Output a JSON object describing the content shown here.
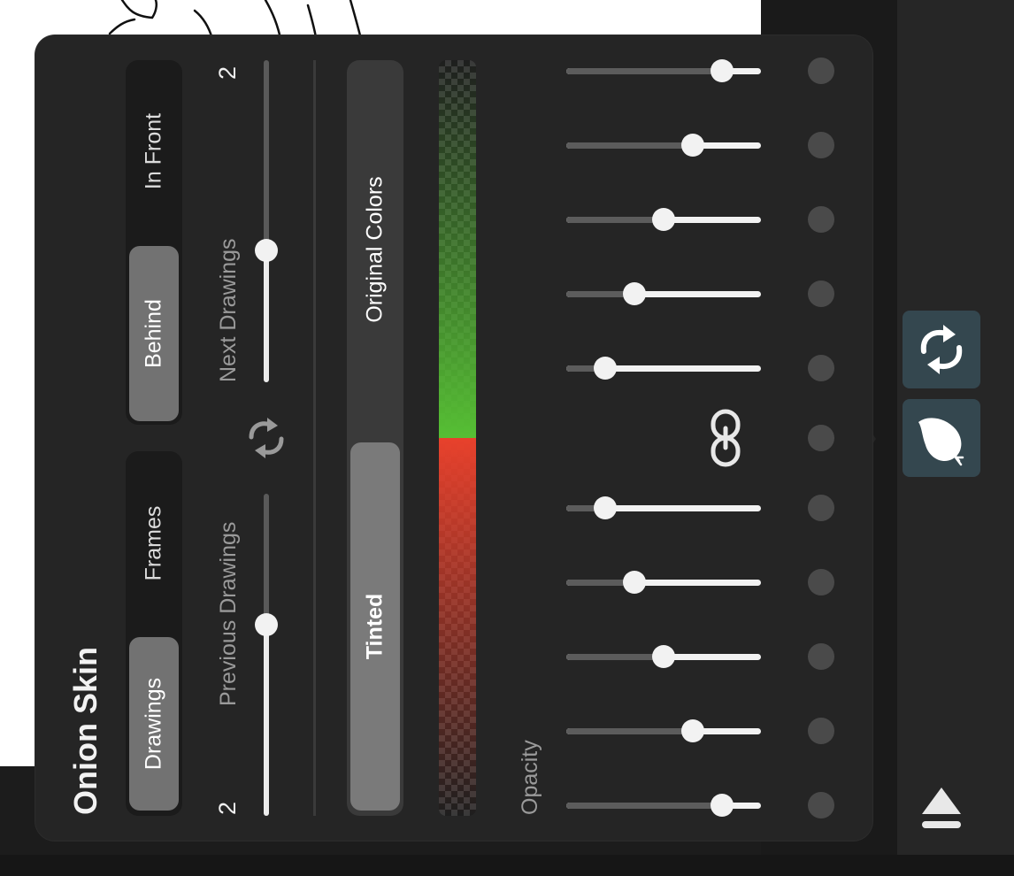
{
  "panel": {
    "title": "Onion Skin",
    "mode_segment": {
      "options": [
        "Drawings",
        "Frames"
      ],
      "selected": "Drawings"
    },
    "position_segment": {
      "options": [
        "Behind",
        "In Front"
      ],
      "selected": "Behind"
    },
    "previous": {
      "label": "Previous Drawings",
      "count": "2",
      "value": 2
    },
    "next": {
      "label": "Next Drawings",
      "count": "2",
      "value": 2
    },
    "color_segment": {
      "options": [
        "Tinted",
        "Original Colors"
      ],
      "selected": "Tinted"
    },
    "tint_colors": {
      "previous": "#e8412c",
      "next": "#56bf34"
    },
    "opacity": {
      "label": "Opacity",
      "previous_levels": [
        0.8,
        0.65,
        0.5,
        0.35,
        0.2
      ],
      "next_levels": [
        0.2,
        0.35,
        0.5,
        0.65,
        0.8
      ],
      "linked": true
    }
  },
  "toolbar": {
    "items": [
      {
        "icon": "cycle-arrows-icon",
        "active": true
      },
      {
        "icon": "onion-icon",
        "active": true
      },
      {
        "icon": "eject-icon",
        "active": false
      }
    ]
  },
  "colors": {
    "panel_bg": "#252525",
    "accent_button": "#34474f"
  }
}
